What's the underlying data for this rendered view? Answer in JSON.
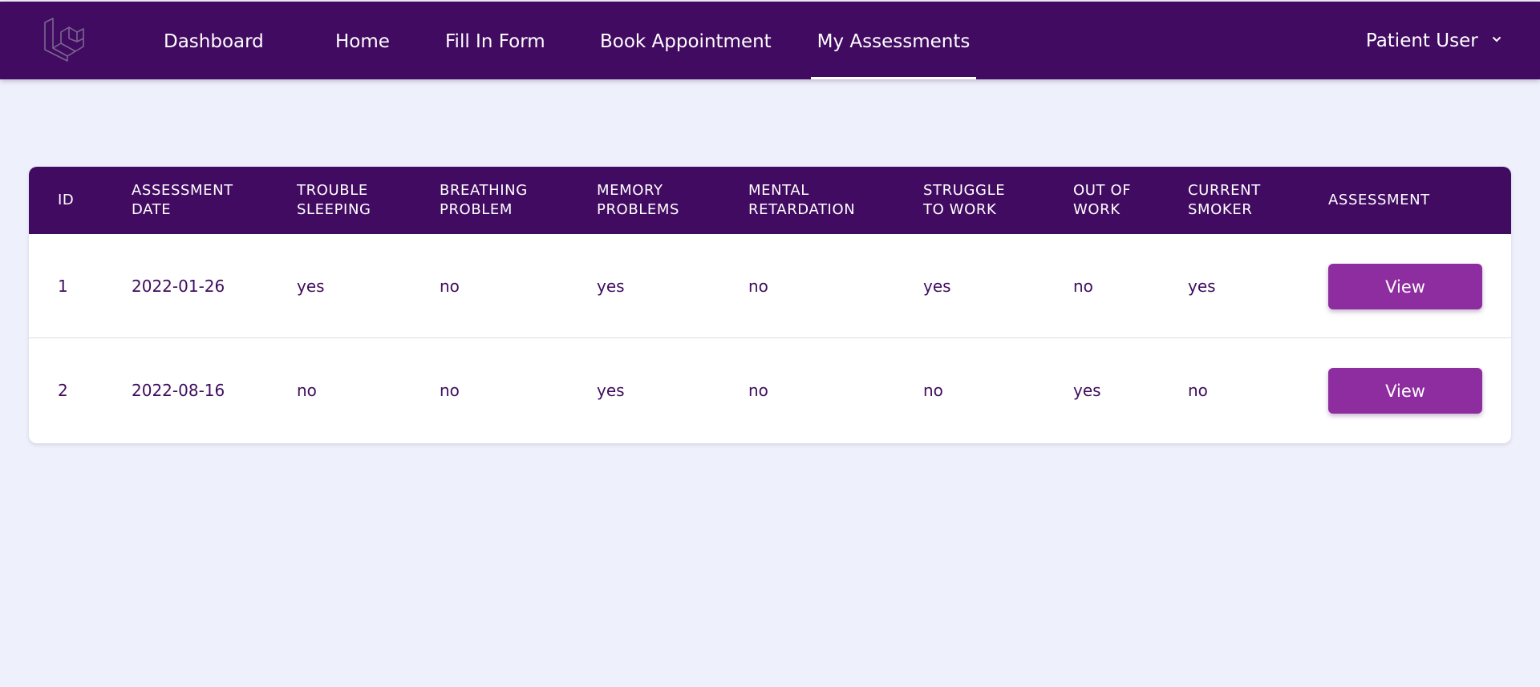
{
  "nav": {
    "links": [
      {
        "label": "Dashboard"
      },
      {
        "label": "Home"
      },
      {
        "label": "Fill In Form"
      },
      {
        "label": "Book Appointment"
      },
      {
        "label": "My Assessments"
      }
    ],
    "active": "My Assessments",
    "user_label": "Patient User"
  },
  "table": {
    "headers": [
      [
        "ID"
      ],
      [
        "ASSESSMENT",
        "DATE"
      ],
      [
        "TROUBLE",
        "SLEEPING"
      ],
      [
        "BREATHING",
        "PROBLEM"
      ],
      [
        "MEMORY",
        "PROBLEMS"
      ],
      [
        "MENTAL",
        "RETARDATION"
      ],
      [
        "STRUGGLE",
        "TO WORK"
      ],
      [
        "OUT OF",
        "WORK"
      ],
      [
        "CURRENT",
        "SMOKER"
      ],
      [
        "ASSESSMENT"
      ]
    ],
    "rows": [
      {
        "cells": [
          "1",
          "2022-01-26",
          "yes",
          "no",
          "yes",
          "no",
          "yes",
          "no",
          "yes"
        ],
        "action": "View"
      },
      {
        "cells": [
          "2",
          "2022-08-16",
          "no",
          "no",
          "yes",
          "no",
          "no",
          "yes",
          "no"
        ],
        "action": "View"
      }
    ]
  },
  "colors": {
    "nav_bg": "#420b62",
    "page_bg": "#eef0fb",
    "button_bg": "#8e2d9f",
    "cell_text": "#3f0d5e"
  },
  "icons": {
    "logo": "laravel-logo-icon",
    "user_menu": "chevron-down-icon"
  }
}
